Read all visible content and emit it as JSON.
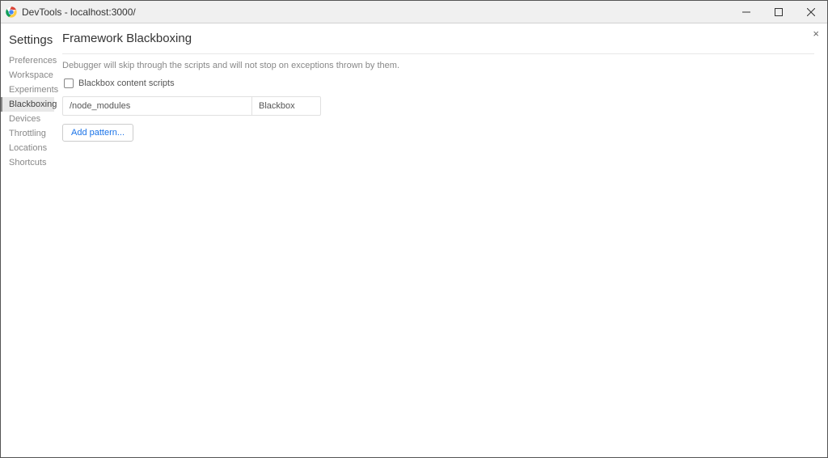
{
  "window": {
    "title": "DevTools - localhost:3000/"
  },
  "sidebar": {
    "title": "Settings",
    "items": [
      {
        "label": "Preferences",
        "active": false
      },
      {
        "label": "Workspace",
        "active": false
      },
      {
        "label": "Experiments",
        "active": false
      },
      {
        "label": "Blackboxing",
        "active": true
      },
      {
        "label": "Devices",
        "active": false
      },
      {
        "label": "Throttling",
        "active": false
      },
      {
        "label": "Locations",
        "active": false
      },
      {
        "label": "Shortcuts",
        "active": false
      }
    ]
  },
  "main": {
    "title": "Framework Blackboxing",
    "description": "Debugger will skip through the scripts and will not stop on exceptions thrown by them.",
    "checkbox_label": "Blackbox content scripts",
    "checkbox_checked": false,
    "patterns": [
      {
        "pattern": "/node_modules",
        "behavior": "Blackbox"
      }
    ],
    "add_pattern_label": "Add pattern..."
  },
  "close_label": "×"
}
